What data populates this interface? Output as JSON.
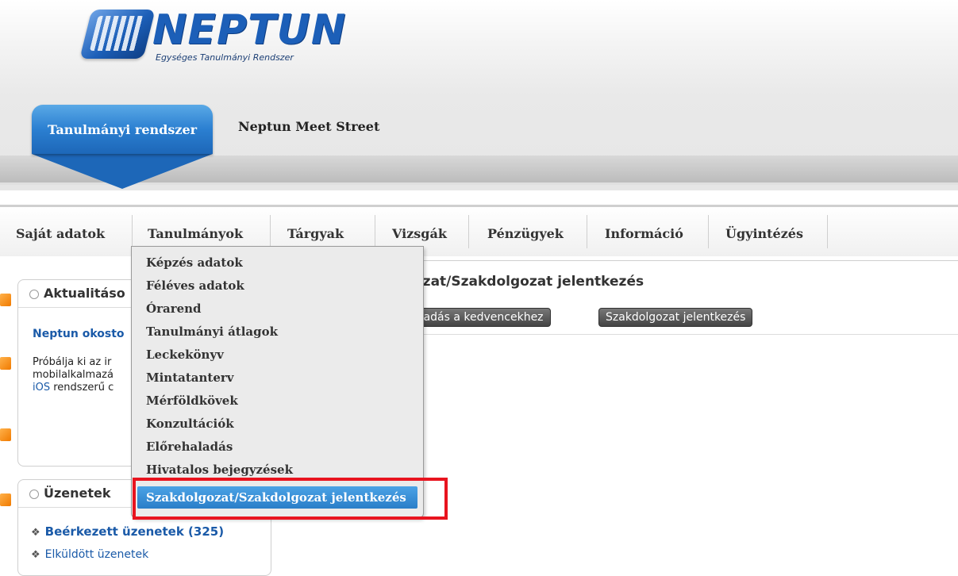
{
  "header": {
    "logo_text": "NEPTUN",
    "logo_subtitle": "Egységes Tanulmányi Rendszer",
    "system_tab": "Tanulmányi rendszer",
    "system_link": "Neptun Meet Street"
  },
  "mainnav": {
    "items": [
      {
        "label": "Saját adatok"
      },
      {
        "label": "Tanulmányok"
      },
      {
        "label": "Tárgyak"
      },
      {
        "label": "Vizsgák"
      },
      {
        "label": "Pénzügyek"
      },
      {
        "label": "Információ"
      },
      {
        "label": "Ügyintézés"
      }
    ]
  },
  "dropdown": {
    "items": [
      "Képzés adatok",
      "Féléves adatok",
      "Órarend",
      "Tanulmányi átlagok",
      "Leckekönyv",
      "Mintatanterv",
      "Mérföldkövek",
      "Konzultációk",
      "Előrehaladás",
      "Hivatalos bejegyzések"
    ],
    "selected": "Szakdolgozat/Szakdolgozat jelentkezés"
  },
  "content": {
    "title_partial": "ozat/Szakdolgozat jelentkezés",
    "fav_button_partial": "áadás a kedvencekhez",
    "thesis_button": "Szakdolgozat jelentkezés"
  },
  "news_panel": {
    "title_partial": "Aktualitáso",
    "link_partial": "Neptun okosto",
    "text_line1_partial": "Próbálja ki az ir",
    "text_line2_partial": "mobilalkalmazá",
    "text_line3_ios": "iOS",
    "text_line3_rest": " rendszerű c"
  },
  "messages_panel": {
    "title": "Üzenetek",
    "inbox": "Beérkezett üzenetek (325)",
    "sent_partial": "Elküldött üzenetek"
  },
  "colors": {
    "brand_blue": "#1c5fb8",
    "selected_blue": "#2a7ec8",
    "highlight_red": "#e8141f"
  }
}
